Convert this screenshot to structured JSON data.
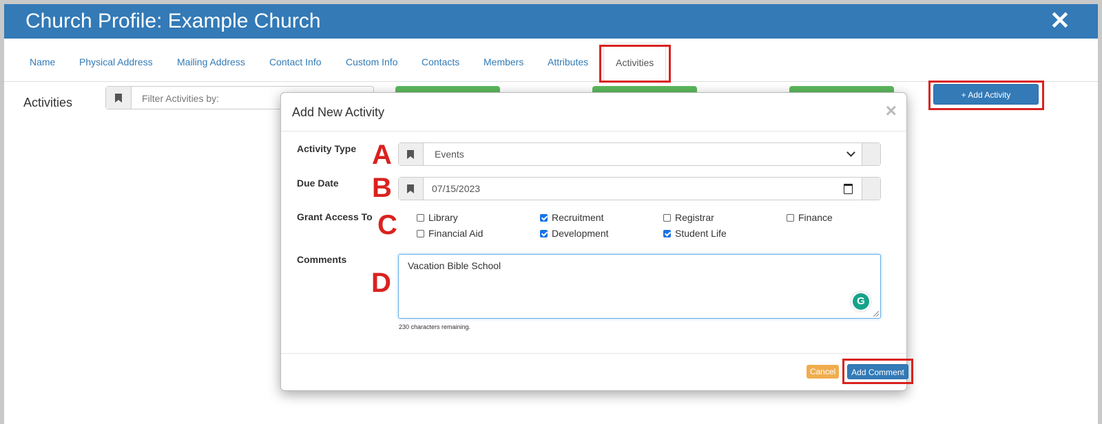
{
  "window": {
    "title": "Church Profile: Example Church",
    "close_glyph": "✕"
  },
  "tabs": [
    {
      "label": "Name"
    },
    {
      "label": "Physical Address"
    },
    {
      "label": "Mailing Address"
    },
    {
      "label": "Contact Info"
    },
    {
      "label": "Custom Info"
    },
    {
      "label": "Contacts"
    },
    {
      "label": "Members"
    },
    {
      "label": "Attributes"
    },
    {
      "label": "Activities",
      "active": true
    }
  ],
  "activities_panel": {
    "heading": "Activities",
    "filter_placeholder": "Filter Activities by:",
    "add_activity_label": "+ Add Activity"
  },
  "modal": {
    "title": "Add New Activity",
    "close_glyph": "×",
    "activity_type": {
      "label": "Activity Type",
      "value": "Events"
    },
    "due_date": {
      "label": "Due Date",
      "value": "07/15/2023"
    },
    "grant_access": {
      "label": "Grant Access To",
      "options": [
        {
          "label": "Library",
          "checked": false
        },
        {
          "label": "Recruitment",
          "checked": true
        },
        {
          "label": "Registrar",
          "checked": false
        },
        {
          "label": "Finance",
          "checked": false
        },
        {
          "label": "Financial Aid",
          "checked": false
        },
        {
          "label": "Development",
          "checked": true
        },
        {
          "label": "Student Life",
          "checked": true
        }
      ]
    },
    "comments": {
      "label": "Comments",
      "value": "Vacation Bible School",
      "chars_remaining": "230 characters remaining."
    },
    "cancel_label": "Cancel",
    "submit_label": "Add Comment"
  },
  "annotations": {
    "a": "A",
    "b": "B",
    "c": "C",
    "d": "D"
  },
  "colors": {
    "header": "#337ab7",
    "highlight": "#d9221f",
    "success": "#5cb85c",
    "warning": "#f0ad4e",
    "checkbox": "#1a73e8",
    "grammarly": "#15a38a"
  }
}
